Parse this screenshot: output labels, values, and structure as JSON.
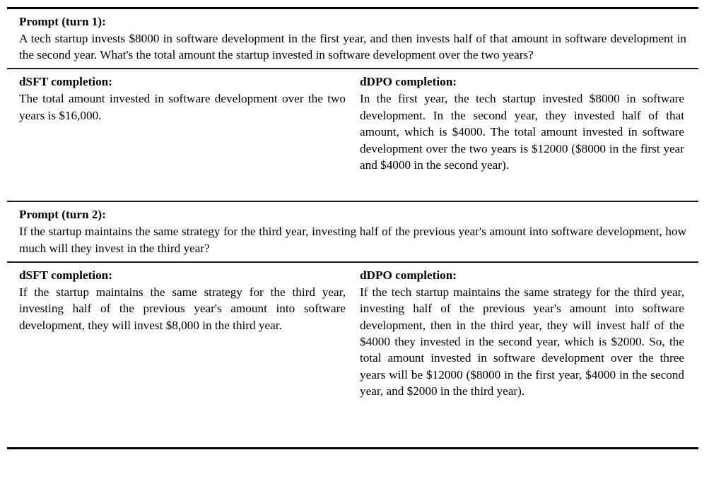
{
  "document": {
    "type": "comparison-table",
    "turns": [
      {
        "prompt": {
          "header": "Prompt (turn 1):",
          "text": "A tech startup invests $8000 in software development in the first year, and then invests half of that amount in software development in the second year.  What's the total amount the startup invested in software development over the two years?"
        },
        "completions": {
          "left": {
            "header": "dSFT completion:",
            "text": "The total amount invested in software development over the two years is $16,000."
          },
          "right": {
            "header": "dDPO completion:",
            "text": "In the first year, the tech startup invested $8000 in software development. In the second year, they invested half of that amount, which is $4000. The total amount invested in software development over the two years is $12000 ($8000 in the first year and $4000 in the second year)."
          }
        }
      },
      {
        "prompt": {
          "header": "Prompt (turn 2):",
          "text": "If the startup maintains the same strategy for the third year, investing half of the previous year's amount into software development, how much will they invest in the third year?"
        },
        "completions": {
          "left": {
            "header": "dSFT completion:",
            "text": "If the startup maintains the same strategy for the third year, investing half of the previous year's amount into software development, they will invest $8,000 in the third year."
          },
          "right": {
            "header": "dDPO completion:",
            "text": "If the tech startup maintains the same strategy for the third year, investing half of the previous year's amount into software development, then in the third year, they will invest half of the $4000 they invested in the second year, which is $2000.  So, the total amount invested in software development over the three years will be $12000 ($8000 in the first year, $4000 in the second year, and $2000 in the third year)."
          }
        }
      }
    ]
  }
}
